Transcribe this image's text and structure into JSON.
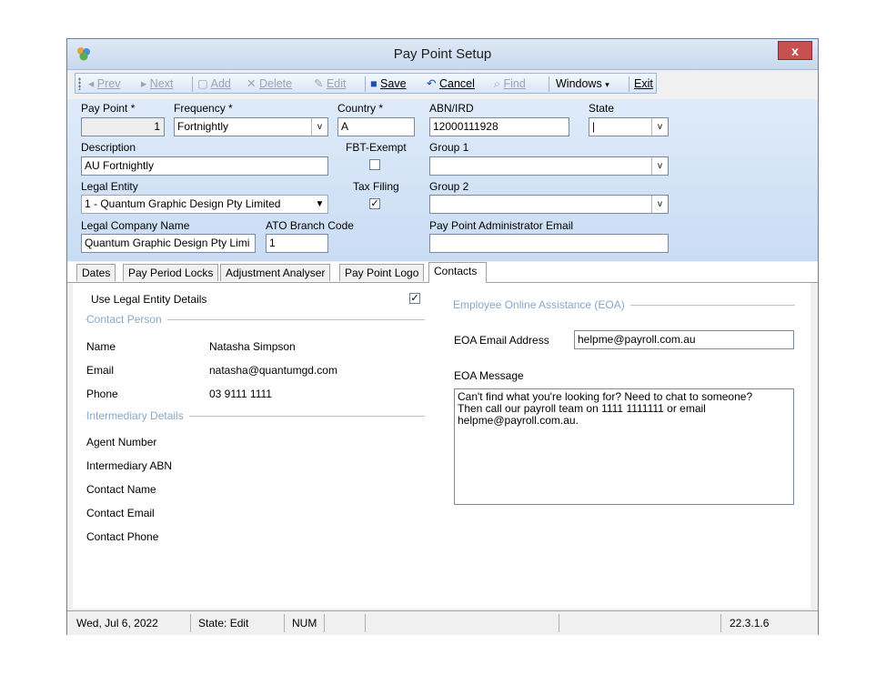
{
  "window": {
    "title": "Pay Point Setup",
    "close_label": "x"
  },
  "toolbar": {
    "prev": "Prev",
    "next": "Next",
    "add": "Add",
    "delete": "Delete",
    "edit": "Edit",
    "save": "Save",
    "cancel": "Cancel",
    "find": "Find",
    "windows": "Windows",
    "exit": "Exit"
  },
  "header": {
    "pay_point_label": "Pay Point *",
    "pay_point_value": "1",
    "frequency_label": "Frequency *",
    "frequency_value": "Fortnightly",
    "country_label": "Country *",
    "country_value": "A",
    "abn_label": "ABN/IRD",
    "abn_value": "12000111928",
    "state_label": "State",
    "state_value": "",
    "description_label": "Description",
    "description_value": "AU Fortnightly",
    "fbt_label": "FBT-Exempt",
    "fbt_checked": false,
    "group1_label": "Group 1",
    "group1_value": "",
    "legal_entity_label": "Legal Entity",
    "legal_entity_value": "1 - Quantum Graphic Design Pty Limited",
    "tax_filing_label": "Tax Filing",
    "tax_filing_checked": true,
    "group2_label": "Group 2",
    "group2_value": "",
    "legal_company_label": "Legal Company Name",
    "legal_company_value": "Quantum Graphic Design Pty Limi",
    "ato_branch_label": "ATO Branch Code",
    "ato_branch_value": "1",
    "admin_email_label": "Pay Point Administrator Email",
    "admin_email_value": ""
  },
  "tabs": [
    "Dates",
    "Pay Period Locks",
    "Adjustment Analyser",
    "Pay Point Logo",
    "Contacts"
  ],
  "contacts": {
    "use_legal_label": "Use Legal Entity Details",
    "use_legal_checked": true,
    "contact_person_title": "Contact Person",
    "name_label": "Name",
    "name_value": "Natasha Simpson",
    "email_label": "Email",
    "email_value": "natasha@quantumgd.com",
    "phone_label": "Phone",
    "phone_value": "03 9111 1111",
    "intermediary_title": "Intermediary Details",
    "agent_number_label": "Agent Number",
    "intermediary_abn_label": "Intermediary ABN",
    "contact_name_label": "Contact Name",
    "contact_email_label": "Contact Email",
    "contact_phone_label": "Contact Phone",
    "eoa_title": "Employee Online Assistance (EOA)",
    "eoa_email_label": "EOA Email Address",
    "eoa_email_value": "helpme@payroll.com.au",
    "eoa_message_label": "EOA Message",
    "eoa_message_value": "Can't find what you're looking for? Need to chat to someone?\nThen call our payroll team on 1111 1111111 or email\nhelpme@payroll.com.au."
  },
  "status": {
    "date": "Wed, Jul 6, 2022",
    "state": "State: Edit",
    "num": "NUM",
    "version": "22.3.1.6"
  }
}
